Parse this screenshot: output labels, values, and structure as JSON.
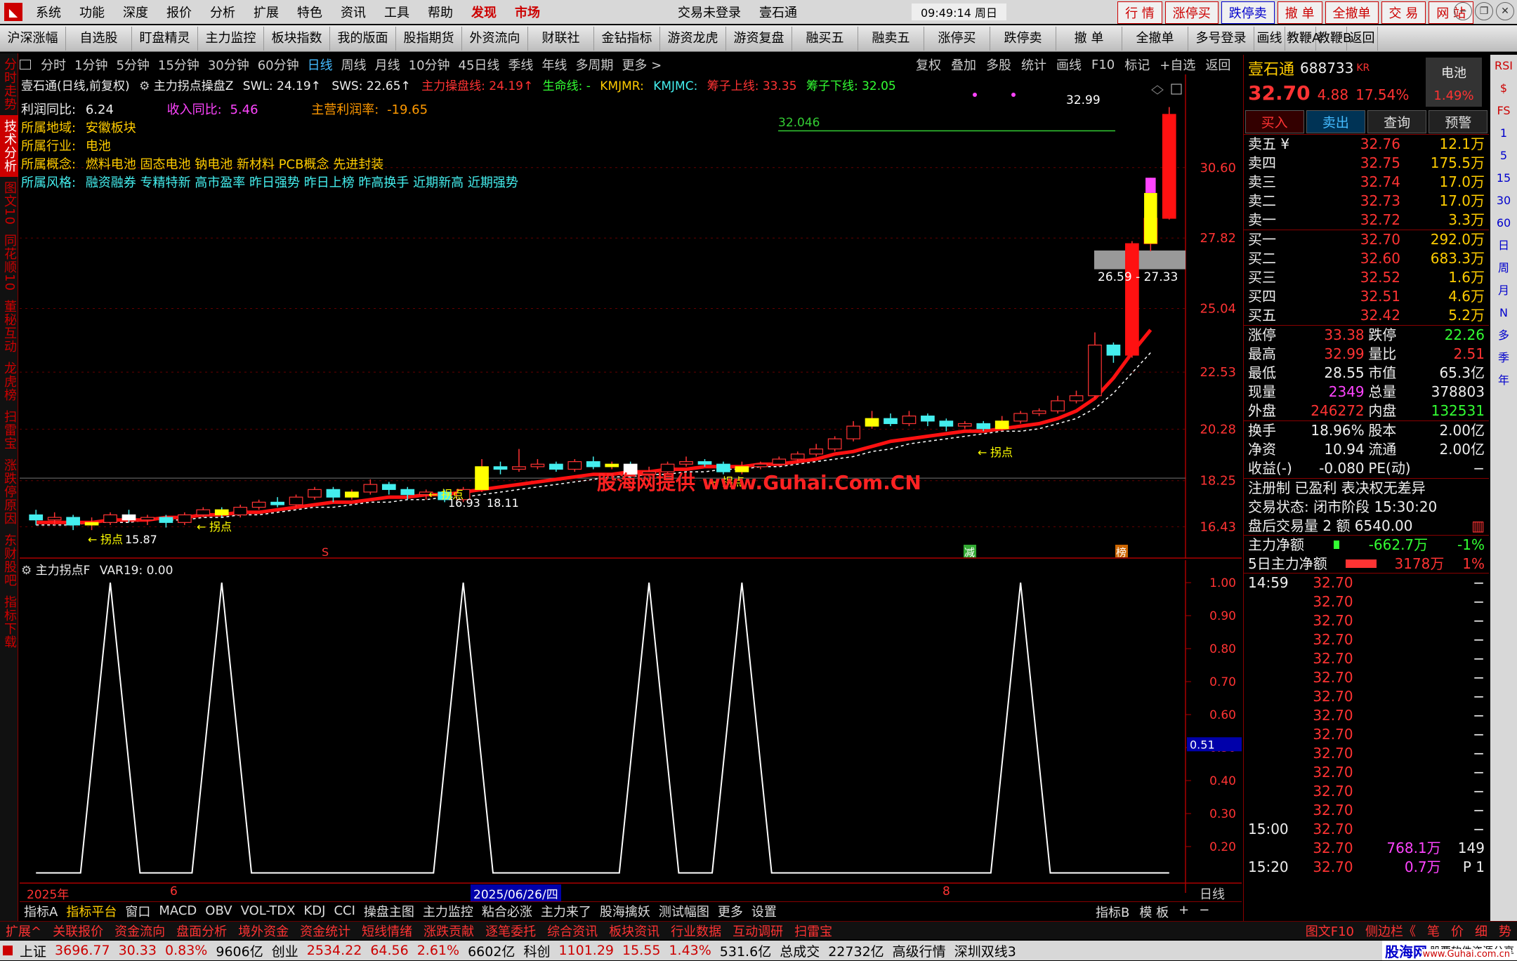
{
  "menubar": {
    "items": [
      "系统",
      "功能",
      "深度",
      "报价",
      "分析",
      "扩展",
      "特色",
      "资讯",
      "工具",
      "帮助"
    ],
    "discover": "发现",
    "market": "市场",
    "login_status": "交易未登录",
    "stock_name": "壹石通",
    "time": "09:49:14 周日",
    "right_buttons": [
      "行 情",
      "涨停买",
      "跌停卖",
      "撤 单",
      "全撤单",
      "交 易",
      "网 站"
    ]
  },
  "toolbar": {
    "items": [
      "沪深涨幅",
      "自选股",
      "盯盘精灵",
      "主力监控",
      "板块指数",
      "我的版面",
      "股指期货",
      "外资流向",
      "财联社",
      "金钻指标",
      "游资龙虎",
      "游资复盘",
      "融买五",
      "融卖五",
      "涨停买",
      "跌停卖",
      "撤 单",
      "全撤单",
      "多号登录",
      "画线",
      "教鞭A",
      "教鞭B",
      "返回"
    ]
  },
  "lefttabs": [
    "分时走势",
    "技术分析",
    "图文10",
    "同花顺10",
    "董秘互动",
    "龙虎榜",
    "扫雷宝",
    "涨跌停原因",
    "东财股吧",
    "指标下载"
  ],
  "periods": [
    "分时",
    "1分钟",
    "5分钟",
    "15分钟",
    "30分钟",
    "60分钟",
    "日线",
    "周线",
    "月线",
    "10分钟",
    "45日线",
    "季线",
    "年线",
    "多周期",
    "更多 >"
  ],
  "period_right": [
    "复权",
    "叠加",
    "多股",
    "统计",
    "画线",
    "F10",
    "标记",
    "+自选",
    "返回"
  ],
  "chart_header": {
    "title": "壹石通(日线,前复权)",
    "indicator": "主力拐点操盘Z",
    "swl": "SWL: 24.19↑",
    "sws": "SWS: 22.65↑",
    "line1": "主力操盘线: 24.19↑",
    "line2": "生命线: -",
    "line3": "KMJMR:",
    "line4": "KMJMC:",
    "line5": "筹子上线: 33.35",
    "line6": "筹子下线: 32.05"
  },
  "info": {
    "profit_label": "利润同比:",
    "profit_val": "6.24",
    "income_label": "收入同比:",
    "income_val": "5.46",
    "margin_label": "主营利润率:",
    "margin_val": "-19.65",
    "region_label": "所属地域:",
    "region_val": "安徽板块",
    "industry_label": "所属行业:",
    "industry_val": "电池",
    "concept_label": "所属概念:",
    "concept_val": "燃料电池 固态电池 钠电池 新材料 PCB概念 先进封装",
    "style_label": "所属风格:",
    "style_val": "融资融券 专精特新 高市盈率 昨日强势 昨日上榜 昨高换手 近期新高 近期强势"
  },
  "price_axis": [
    "30.60",
    "27.82",
    "25.04",
    "22.53",
    "20.28",
    "18.25",
    "16.43"
  ],
  "annotations": {
    "top_price": "32.99",
    "line_price": "32.046",
    "gap_range": "26.59 - 27.33",
    "low_price": "18.11",
    "low_prefix": "16.93",
    "left_price": "15.87",
    "turn": "拐点",
    "watermark": "股海网提供 www.Guhai.Com.CN",
    "marker_s": "S",
    "marker_jian": "减",
    "marker_bang": "榜"
  },
  "sub_chart": {
    "title": "主力拐点F",
    "var": "VAR19: 0.00",
    "axis": [
      "1.00",
      "0.90",
      "0.80",
      "0.70",
      "0.60",
      "0.50",
      "0.40",
      "0.30",
      "0.20"
    ],
    "cursor_val": "0.51",
    "pulses": [
      4,
      10,
      23,
      33,
      38,
      53
    ],
    "bars": 62
  },
  "date_axis": {
    "year": "2025年",
    "m6": "6",
    "date": "2025/06/26/四",
    "m8": "8",
    "period": "日线"
  },
  "bottomtabs": [
    "指标A",
    "指标平台",
    "窗口",
    "MACD",
    "OBV",
    "VOL-TDX",
    "KDJ",
    "CCI",
    "操盘主图",
    "主力监控",
    "粘合必涨",
    "主力来了",
    "股海擒妖",
    "测试幅图",
    "更多",
    "设置"
  ],
  "bottom_right": [
    "指标B",
    "模 板",
    "+",
    "−"
  ],
  "statusbar1": [
    "扩展^",
    "关联报价",
    "资金流向",
    "盘面分析",
    "境外资金",
    "资金统计",
    "短线情绪",
    "涨跌贡献",
    "逐笔委托",
    "综合资讯",
    "板块资讯",
    "行业数据",
    "互动调研",
    "扫雷宝"
  ],
  "statusbar1_right": [
    "图文F10",
    "侧边栏《",
    "笔",
    "价",
    "细",
    "势"
  ],
  "statusbar2": {
    "sh_label": "上证",
    "sh_val": "3696.77",
    "sh_chg": "30.33",
    "sh_pct": "0.83%",
    "sh_amt": "9606亿",
    "cy_label": "创业",
    "cy_val": "2534.22",
    "cy_chg": "64.56",
    "cy_pct": "2.61%",
    "cy_amt": "6602亿",
    "kc_label": "科创",
    "kc_val": "1101.29",
    "kc_chg": "15.55",
    "kc_pct": "1.43%",
    "kc_amt": "531.6亿",
    "total_label": "总成交",
    "total_val": "22732亿",
    "quote_label": "高级行情",
    "line_label": "深圳双线3",
    "site_brand": "股海网",
    "site_slogan": "股票软件资源分享",
    "site_url": "www.Guhai.com.cn"
  },
  "quote": {
    "name": "壹石通",
    "code": "688733",
    "tag": "KR",
    "sector": "电池",
    "sector_pct": "1.49%",
    "price": "32.70",
    "chg": "4.88",
    "pct": "17.54%",
    "buttons": [
      "买入",
      "卖出",
      "查询",
      "预警"
    ],
    "sells": [
      {
        "label": "卖五 ¥",
        "price": "32.76",
        "vol": "12.1万"
      },
      {
        "label": "卖四",
        "price": "32.75",
        "vol": "175.5万"
      },
      {
        "label": "卖三",
        "price": "32.74",
        "vol": "17.0万"
      },
      {
        "label": "卖二",
        "price": "32.73",
        "vol": "17.0万"
      },
      {
        "label": "卖一",
        "price": "32.72",
        "vol": "3.3万"
      }
    ],
    "buys": [
      {
        "label": "买一",
        "price": "32.70",
        "vol": "292.0万"
      },
      {
        "label": "买二",
        "price": "32.60",
        "vol": "683.3万"
      },
      {
        "label": "买三",
        "price": "32.52",
        "vol": "1.6万"
      },
      {
        "label": "买四",
        "price": "32.51",
        "vol": "4.6万"
      },
      {
        "label": "买五",
        "price": "32.42",
        "vol": "5.2万"
      }
    ],
    "stats": [
      {
        "l1": "涨停",
        "v1": "33.38",
        "l2": "跌停",
        "v2": "22.26"
      },
      {
        "l1": "最高",
        "v1": "32.99",
        "l2": "量比",
        "v2": "2.51"
      },
      {
        "l1": "最低",
        "v1": "28.55",
        "l2": "市值",
        "v2": "65.3亿"
      },
      {
        "l1": "现量",
        "v1": "2349",
        "l2": "总量",
        "v2": "378803"
      },
      {
        "l1": "外盘",
        "v1": "246272",
        "l2": "内盘",
        "v2": "132531"
      }
    ],
    "stats2": [
      {
        "l1": "换手",
        "v1": "18.96%",
        "l2": "股本",
        "v2": "2.00亿"
      },
      {
        "l1": "净资",
        "v1": "10.94",
        "l2": "流通",
        "v2": "2.00亿"
      },
      {
        "l1": "收益(-)",
        "v1": "-0.080",
        "l2": "PE(动)",
        "v2": "−"
      }
    ],
    "reg": "注册制 已盈利 表决权无差异",
    "trade_state": "交易状态: 闭市阶段 15:30:20",
    "after_hours": "盘后交易量 2 额 6540.00",
    "net_label": "主力净额",
    "net_val": "-662.7万",
    "net_pct": "-1%",
    "net5_label": "5日主力净额",
    "net5_val": "3178万",
    "net5_pct": "1%",
    "ticks": [
      {
        "t": "14:59",
        "p": "32.70",
        "v": "",
        "f": "−"
      },
      {
        "t": "",
        "p": "32.70",
        "v": "",
        "f": "−"
      },
      {
        "t": "",
        "p": "32.70",
        "v": "",
        "f": "−"
      },
      {
        "t": "",
        "p": "32.70",
        "v": "",
        "f": "−"
      },
      {
        "t": "",
        "p": "32.70",
        "v": "",
        "f": "−"
      },
      {
        "t": "",
        "p": "32.70",
        "v": "",
        "f": "−"
      },
      {
        "t": "",
        "p": "32.70",
        "v": "",
        "f": "−"
      },
      {
        "t": "",
        "p": "32.70",
        "v": "",
        "f": "−"
      },
      {
        "t": "",
        "p": "32.70",
        "v": "",
        "f": "−"
      },
      {
        "t": "",
        "p": "32.70",
        "v": "",
        "f": "−"
      },
      {
        "t": "",
        "p": "32.70",
        "v": "",
        "f": "−"
      },
      {
        "t": "",
        "p": "32.70",
        "v": "",
        "f": "−"
      },
      {
        "t": "",
        "p": "32.70",
        "v": "",
        "f": "−"
      },
      {
        "t": "15:00",
        "p": "32.70",
        "v": "",
        "f": "−"
      },
      {
        "t": "",
        "p": "32.70",
        "v": "768.1万",
        "f": "149"
      },
      {
        "t": "15:20",
        "p": "32.70",
        "v": "0.7万",
        "f": "P 1"
      }
    ]
  },
  "vert_sidebar": [
    "RSI",
    "$",
    "FS",
    "1",
    "5",
    "15",
    "30",
    "60",
    "日",
    "周",
    "月",
    "N",
    "多",
    "季",
    "年"
  ],
  "chart_data": {
    "type": "candlestick",
    "ylim": [
      15.5,
      34.0
    ],
    "candles": [
      [
        16.9,
        16.7,
        17.1,
        16.5
      ],
      [
        16.7,
        16.8,
        17.0,
        16.5
      ],
      [
        16.8,
        16.5,
        16.9,
        16.3
      ],
      [
        16.5,
        16.6,
        16.8,
        16.3
      ],
      [
        16.6,
        16.9,
        17.0,
        16.5
      ],
      [
        16.9,
        16.7,
        17.1,
        16.6
      ],
      [
        16.7,
        16.8,
        16.9,
        16.5
      ],
      [
        16.8,
        16.6,
        16.9,
        16.4
      ],
      [
        16.6,
        16.9,
        17.0,
        16.5
      ],
      [
        16.9,
        17.1,
        17.2,
        16.8
      ],
      [
        17.1,
        16.9,
        17.2,
        16.8
      ],
      [
        16.9,
        17.2,
        17.3,
        16.8
      ],
      [
        17.2,
        17.4,
        17.5,
        17.1
      ],
      [
        17.4,
        17.3,
        17.6,
        17.2
      ],
      [
        17.3,
        17.6,
        17.7,
        17.2
      ],
      [
        17.6,
        17.9,
        18.0,
        17.5
      ],
      [
        17.9,
        17.6,
        18.0,
        17.4
      ],
      [
        17.6,
        17.8,
        17.9,
        17.5
      ],
      [
        17.8,
        18.1,
        18.3,
        17.7
      ],
      [
        18.1,
        17.9,
        18.2,
        17.7
      ],
      [
        17.9,
        17.7,
        18.0,
        17.5
      ],
      [
        17.7,
        17.8,
        17.9,
        17.5
      ],
      [
        17.8,
        17.5,
        17.9,
        17.4
      ],
      [
        17.5,
        17.9,
        18.0,
        17.4
      ],
      [
        17.9,
        18.8,
        19.1,
        17.8
      ],
      [
        18.8,
        18.7,
        19.0,
        18.5
      ],
      [
        18.7,
        18.8,
        19.5,
        18.6
      ],
      [
        18.8,
        18.9,
        19.1,
        18.7
      ],
      [
        18.9,
        18.7,
        19.0,
        18.6
      ],
      [
        18.7,
        19.0,
        19.1,
        18.6
      ],
      [
        19.0,
        18.8,
        19.2,
        18.7
      ],
      [
        18.8,
        18.9,
        19.0,
        18.7
      ],
      [
        18.9,
        18.5,
        19.0,
        18.3
      ],
      [
        18.5,
        18.6,
        18.8,
        18.4
      ],
      [
        18.6,
        18.9,
        19.0,
        18.5
      ],
      [
        18.9,
        19.0,
        19.2,
        18.8
      ],
      [
        19.0,
        18.9,
        19.1,
        18.8
      ],
      [
        18.9,
        18.6,
        19.0,
        18.5
      ],
      [
        18.6,
        18.8,
        19.0,
        18.5
      ],
      [
        18.8,
        18.9,
        19.0,
        18.7
      ],
      [
        18.9,
        19.1,
        19.2,
        18.8
      ],
      [
        19.1,
        19.3,
        19.4,
        19.0
      ],
      [
        19.3,
        19.5,
        19.7,
        19.2
      ],
      [
        19.5,
        19.9,
        20.0,
        19.4
      ],
      [
        19.9,
        20.4,
        20.6,
        19.8
      ],
      [
        20.4,
        20.7,
        21.0,
        20.3
      ],
      [
        20.7,
        20.5,
        20.9,
        20.4
      ],
      [
        20.5,
        20.8,
        21.0,
        20.4
      ],
      [
        20.8,
        20.6,
        20.9,
        20.4
      ],
      [
        20.6,
        20.4,
        20.7,
        20.2
      ],
      [
        20.4,
        20.5,
        20.6,
        20.3
      ],
      [
        20.5,
        20.3,
        20.6,
        20.2
      ],
      [
        20.3,
        20.6,
        20.8,
        20.2
      ],
      [
        20.6,
        20.9,
        21.0,
        20.5
      ],
      [
        20.9,
        21.0,
        21.1,
        20.8
      ],
      [
        21.0,
        21.4,
        21.6,
        20.9
      ],
      [
        21.4,
        21.6,
        21.8,
        21.3
      ],
      [
        21.6,
        23.6,
        24.1,
        21.5
      ],
      [
        23.6,
        23.2,
        23.7,
        22.9
      ],
      [
        23.2,
        27.6,
        27.7,
        23.1
      ],
      [
        27.6,
        28.6,
        30.2,
        27.3
      ],
      [
        28.6,
        32.7,
        32.99,
        28.55
      ]
    ],
    "ma_red": [
      16.6,
      16.6,
      16.6,
      16.6,
      16.7,
      16.7,
      16.7,
      16.8,
      16.8,
      16.9,
      16.9,
      17.0,
      17.0,
      17.1,
      17.2,
      17.3,
      17.4,
      17.4,
      17.5,
      17.6,
      17.6,
      17.7,
      17.7,
      17.8,
      17.9,
      18.0,
      18.1,
      18.2,
      18.3,
      18.4,
      18.5,
      18.5,
      18.6,
      18.6,
      18.7,
      18.7,
      18.8,
      18.8,
      18.8,
      18.9,
      18.9,
      19.0,
      19.1,
      19.3,
      19.4,
      19.6,
      19.8,
      19.9,
      20.0,
      20.1,
      20.2,
      20.2,
      20.3,
      20.4,
      20.5,
      20.7,
      21.0,
      21.5,
      22.3,
      23.3,
      24.2
    ],
    "ma_white": [
      16.5,
      16.5,
      16.5,
      16.6,
      16.6,
      16.6,
      16.7,
      16.7,
      16.7,
      16.8,
      16.8,
      16.9,
      16.9,
      17.0,
      17.1,
      17.2,
      17.2,
      17.3,
      17.4,
      17.4,
      17.5,
      17.5,
      17.6,
      17.6,
      17.7,
      17.8,
      17.9,
      18.0,
      18.1,
      18.2,
      18.3,
      18.4,
      18.4,
      18.5,
      18.5,
      18.6,
      18.6,
      18.7,
      18.7,
      18.8,
      18.8,
      18.9,
      19.0,
      19.1,
      19.2,
      19.4,
      19.5,
      19.7,
      19.8,
      19.9,
      20.0,
      20.1,
      20.2,
      20.2,
      20.3,
      20.5,
      20.7,
      21.1,
      21.7,
      22.5,
      23.3
    ]
  }
}
